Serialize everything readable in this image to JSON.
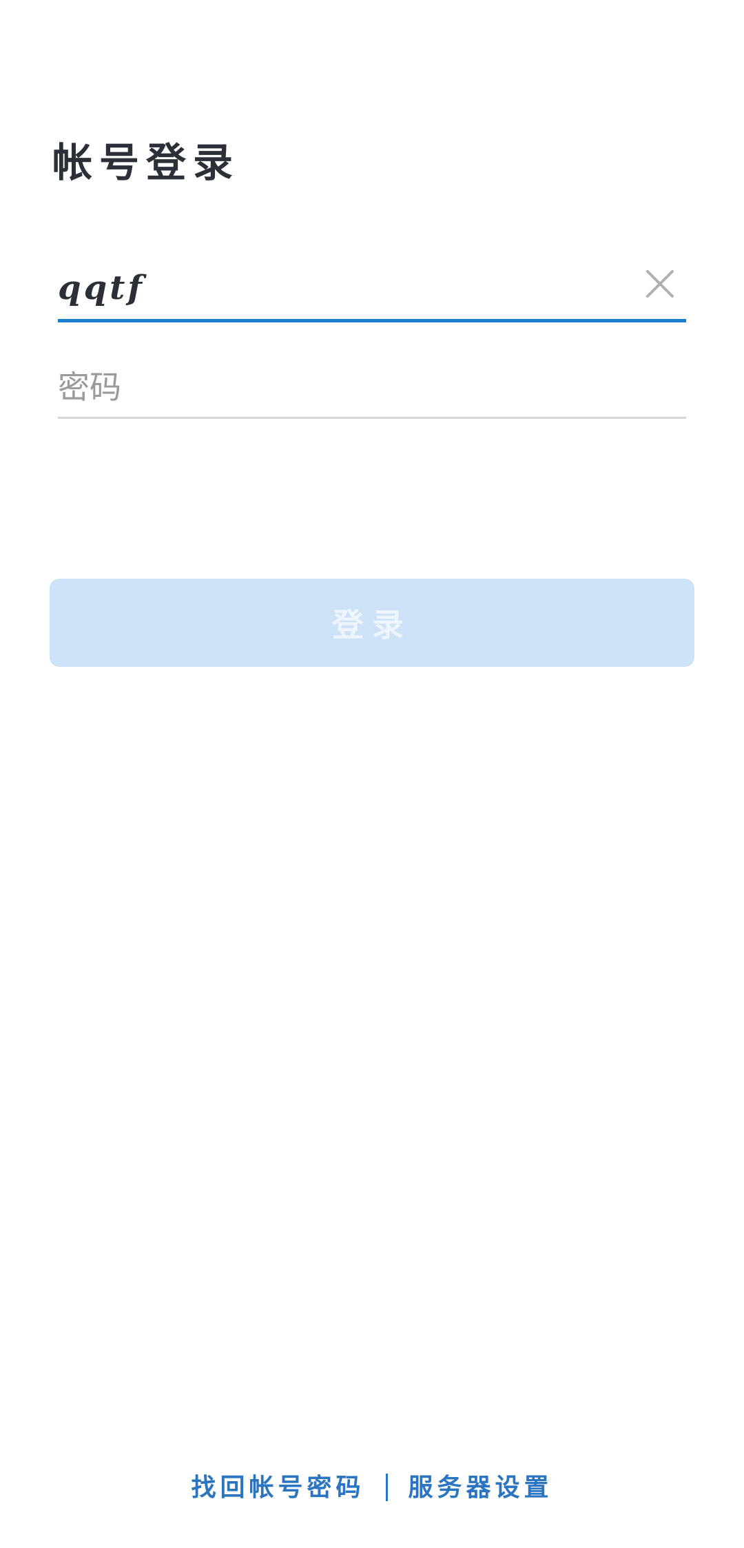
{
  "title": "帐号登录",
  "username": {
    "value": "qqtf",
    "clear_icon": "close-icon"
  },
  "password": {
    "placeholder": "密码",
    "value": ""
  },
  "login_button": {
    "label": "登录",
    "enabled": false
  },
  "footer": {
    "recover_label": "找回帐号密码",
    "server_settings_label": "服务器设置"
  },
  "colors": {
    "accent": "#1a7fd1",
    "link": "#2a74c2",
    "button_disabled_bg": "#cde1f8",
    "text": "#2b2f38",
    "placeholder": "#9a9a9a"
  }
}
